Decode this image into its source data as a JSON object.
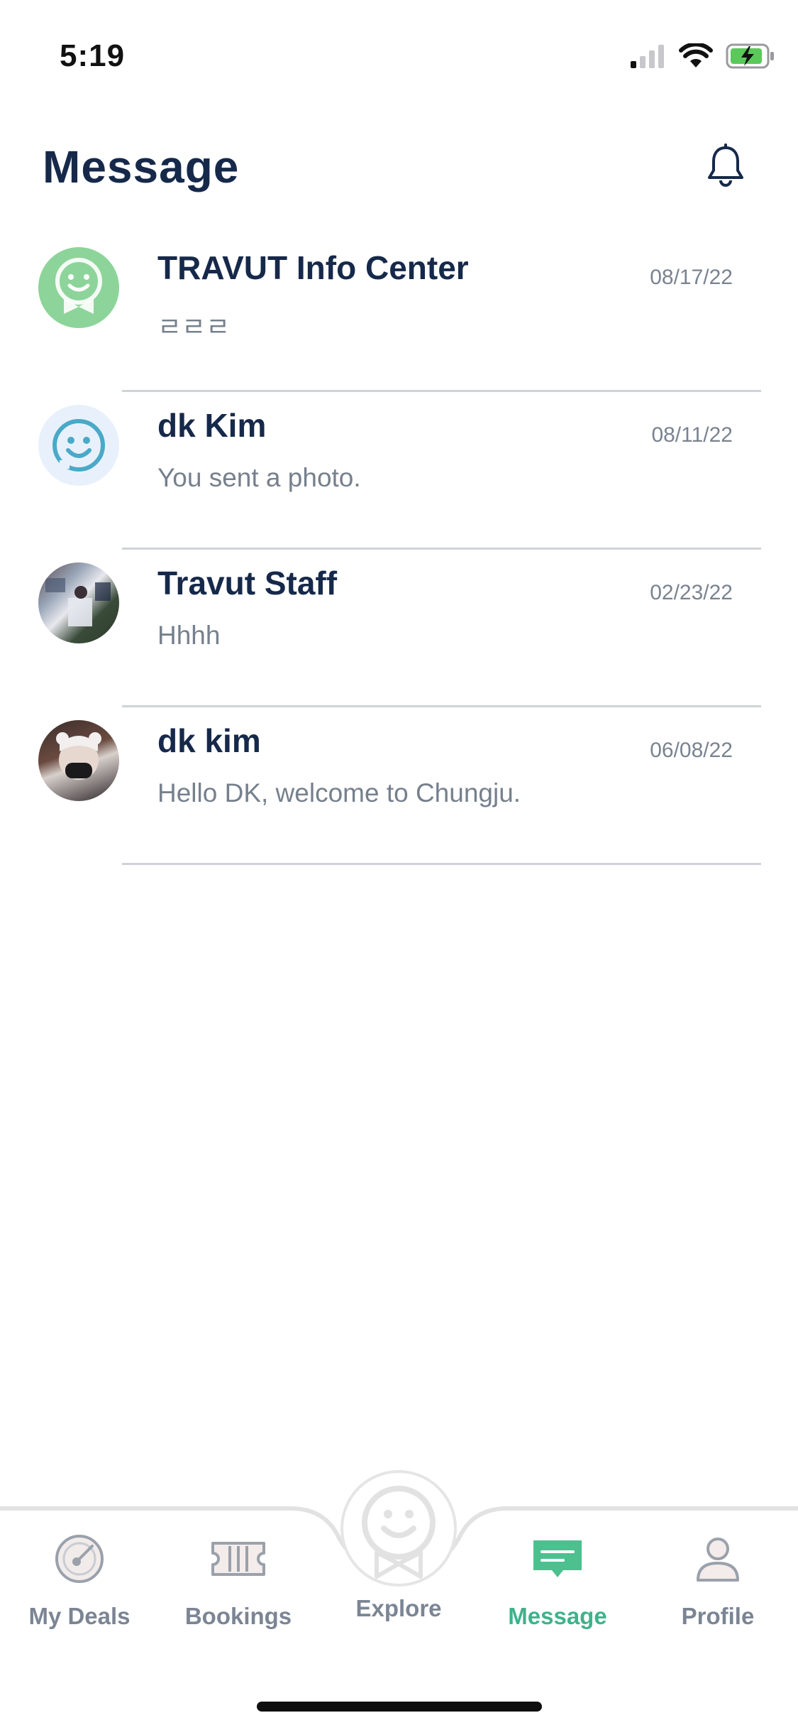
{
  "status_bar": {
    "time": "5:19"
  },
  "header": {
    "title": "Message"
  },
  "conversations": [
    {
      "name": "TRAVUT Info Center",
      "preview": "ㄹㄹㄹ",
      "date": "08/17/22",
      "avatar": "travut-logo-avatar"
    },
    {
      "name": "dk Kim",
      "preview": "You sent a photo.",
      "date": "08/11/22",
      "avatar": "smiley-avatar"
    },
    {
      "name": "Travut Staff",
      "preview": "Hhhh",
      "date": "02/23/22",
      "avatar": "photo-avatar"
    },
    {
      "name": "dk kim",
      "preview": "Hello DK, welcome to Chungju.",
      "date": "06/08/22",
      "avatar": "photo-avatar"
    }
  ],
  "bottom_nav": {
    "items": [
      {
        "label": "My Deals",
        "icon": "deals-gauge-icon",
        "active": false
      },
      {
        "label": "Bookings",
        "icon": "ticket-icon",
        "active": false
      },
      {
        "label": "Explore",
        "icon": "travut-smiley-icon",
        "active": false
      },
      {
        "label": "Message",
        "icon": "chat-bubble-icon",
        "active": true
      },
      {
        "label": "Profile",
        "icon": "person-icon",
        "active": false
      }
    ]
  },
  "colors": {
    "accent": "#3fb28c",
    "title": "#16294a",
    "muted": "#76808d",
    "avatar_green": "#8dd49a"
  }
}
